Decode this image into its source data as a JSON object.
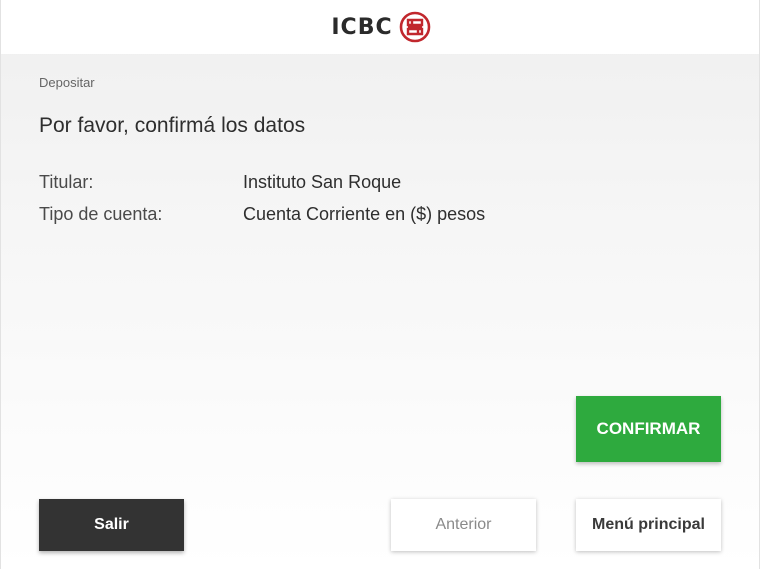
{
  "header": {
    "brand_name": "ICBC",
    "logo_icon": "icbc-seal-icon",
    "brand_color": "#c1272d"
  },
  "breadcrumb": "Depositar",
  "title": "Por favor, confirmá los datos",
  "details": [
    {
      "label": "Titular:",
      "value": "Instituto San Roque"
    },
    {
      "label": "Tipo de cuenta:",
      "value": "Cuenta Corriente en ($) pesos"
    }
  ],
  "actions": {
    "confirm_label": "CONFIRMAR",
    "exit_label": "Salir",
    "previous_label": "Anterior",
    "main_menu_label": "Menú principal"
  },
  "colors": {
    "confirm": "#2eaa3e",
    "exit": "#333333",
    "neutral": "#ffffff"
  }
}
